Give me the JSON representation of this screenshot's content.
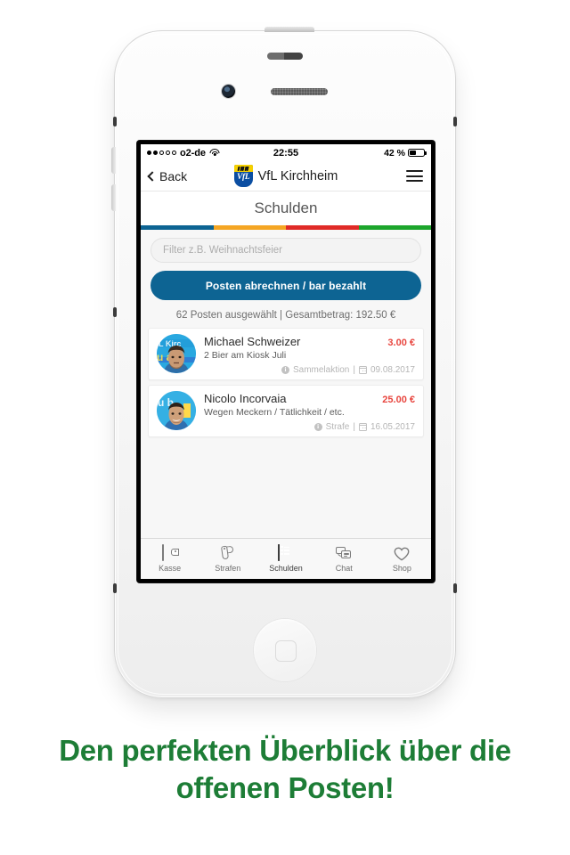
{
  "statusbar": {
    "carrier": "o2-de",
    "signal_dots_filled": 2,
    "signal_dots_total": 5,
    "wifi_icon": "wifi-icon",
    "time": "22:55",
    "location_icon": "location-arrow-icon",
    "battery_percent": "42 %",
    "battery_level": 42
  },
  "navbar": {
    "back_label": "Back",
    "back_icon": "chevron-left-icon",
    "logo_name": "vfl-kirchheim-logo",
    "logo_text": "VfL",
    "title": "VfL Kirchheim",
    "menu_icon": "hamburger-menu-icon"
  },
  "page": {
    "title": "Schulden",
    "segment_colors": [
      "#0d6493",
      "#f5a623",
      "#e02b27",
      "#1ca62c"
    ]
  },
  "filter": {
    "value": "",
    "placeholder": "Filter z.B. Weihnachtsfeier"
  },
  "cta": {
    "label": "Posten abrechnen / bar bezahlt",
    "color": "#0d6493"
  },
  "summary": {
    "text": "62 Posten ausgewählt | Gesamtbetrag: 192.50 €",
    "count": 62,
    "total": "192.50 €"
  },
  "list": [
    {
      "avatar": "player-avatar",
      "name": "Michael Schweizer",
      "reason": "2 Bier am Kiosk Juli",
      "amount": "3.00 €",
      "type_icon": "info-icon",
      "type": "Sammelaktion",
      "separator": "|",
      "date_icon": "calendar-icon",
      "date": "09.08.2017"
    },
    {
      "avatar": "player-avatar",
      "name": "Nicolo Incorvaia",
      "reason": "Wegen Meckern / Tätlichkeit / etc.",
      "amount": "25.00 €",
      "type_icon": "info-icon",
      "type": "Strafe",
      "separator": "|",
      "date_icon": "calendar-icon",
      "date": "16.05.2017"
    }
  ],
  "tabbar": {
    "active": "Schulden",
    "items": [
      {
        "label": "Kasse",
        "icon": "wallet-icon"
      },
      {
        "label": "Strafen",
        "icon": "whistle-icon"
      },
      {
        "label": "Schulden",
        "icon": "list-icon"
      },
      {
        "label": "Chat",
        "icon": "chat-bubbles-icon"
      },
      {
        "label": "Shop",
        "icon": "heart-icon"
      }
    ]
  },
  "caption": {
    "line1": "Den perfekten Überblick über die",
    "line2": "offenen Posten!",
    "color": "#1d7d36"
  }
}
